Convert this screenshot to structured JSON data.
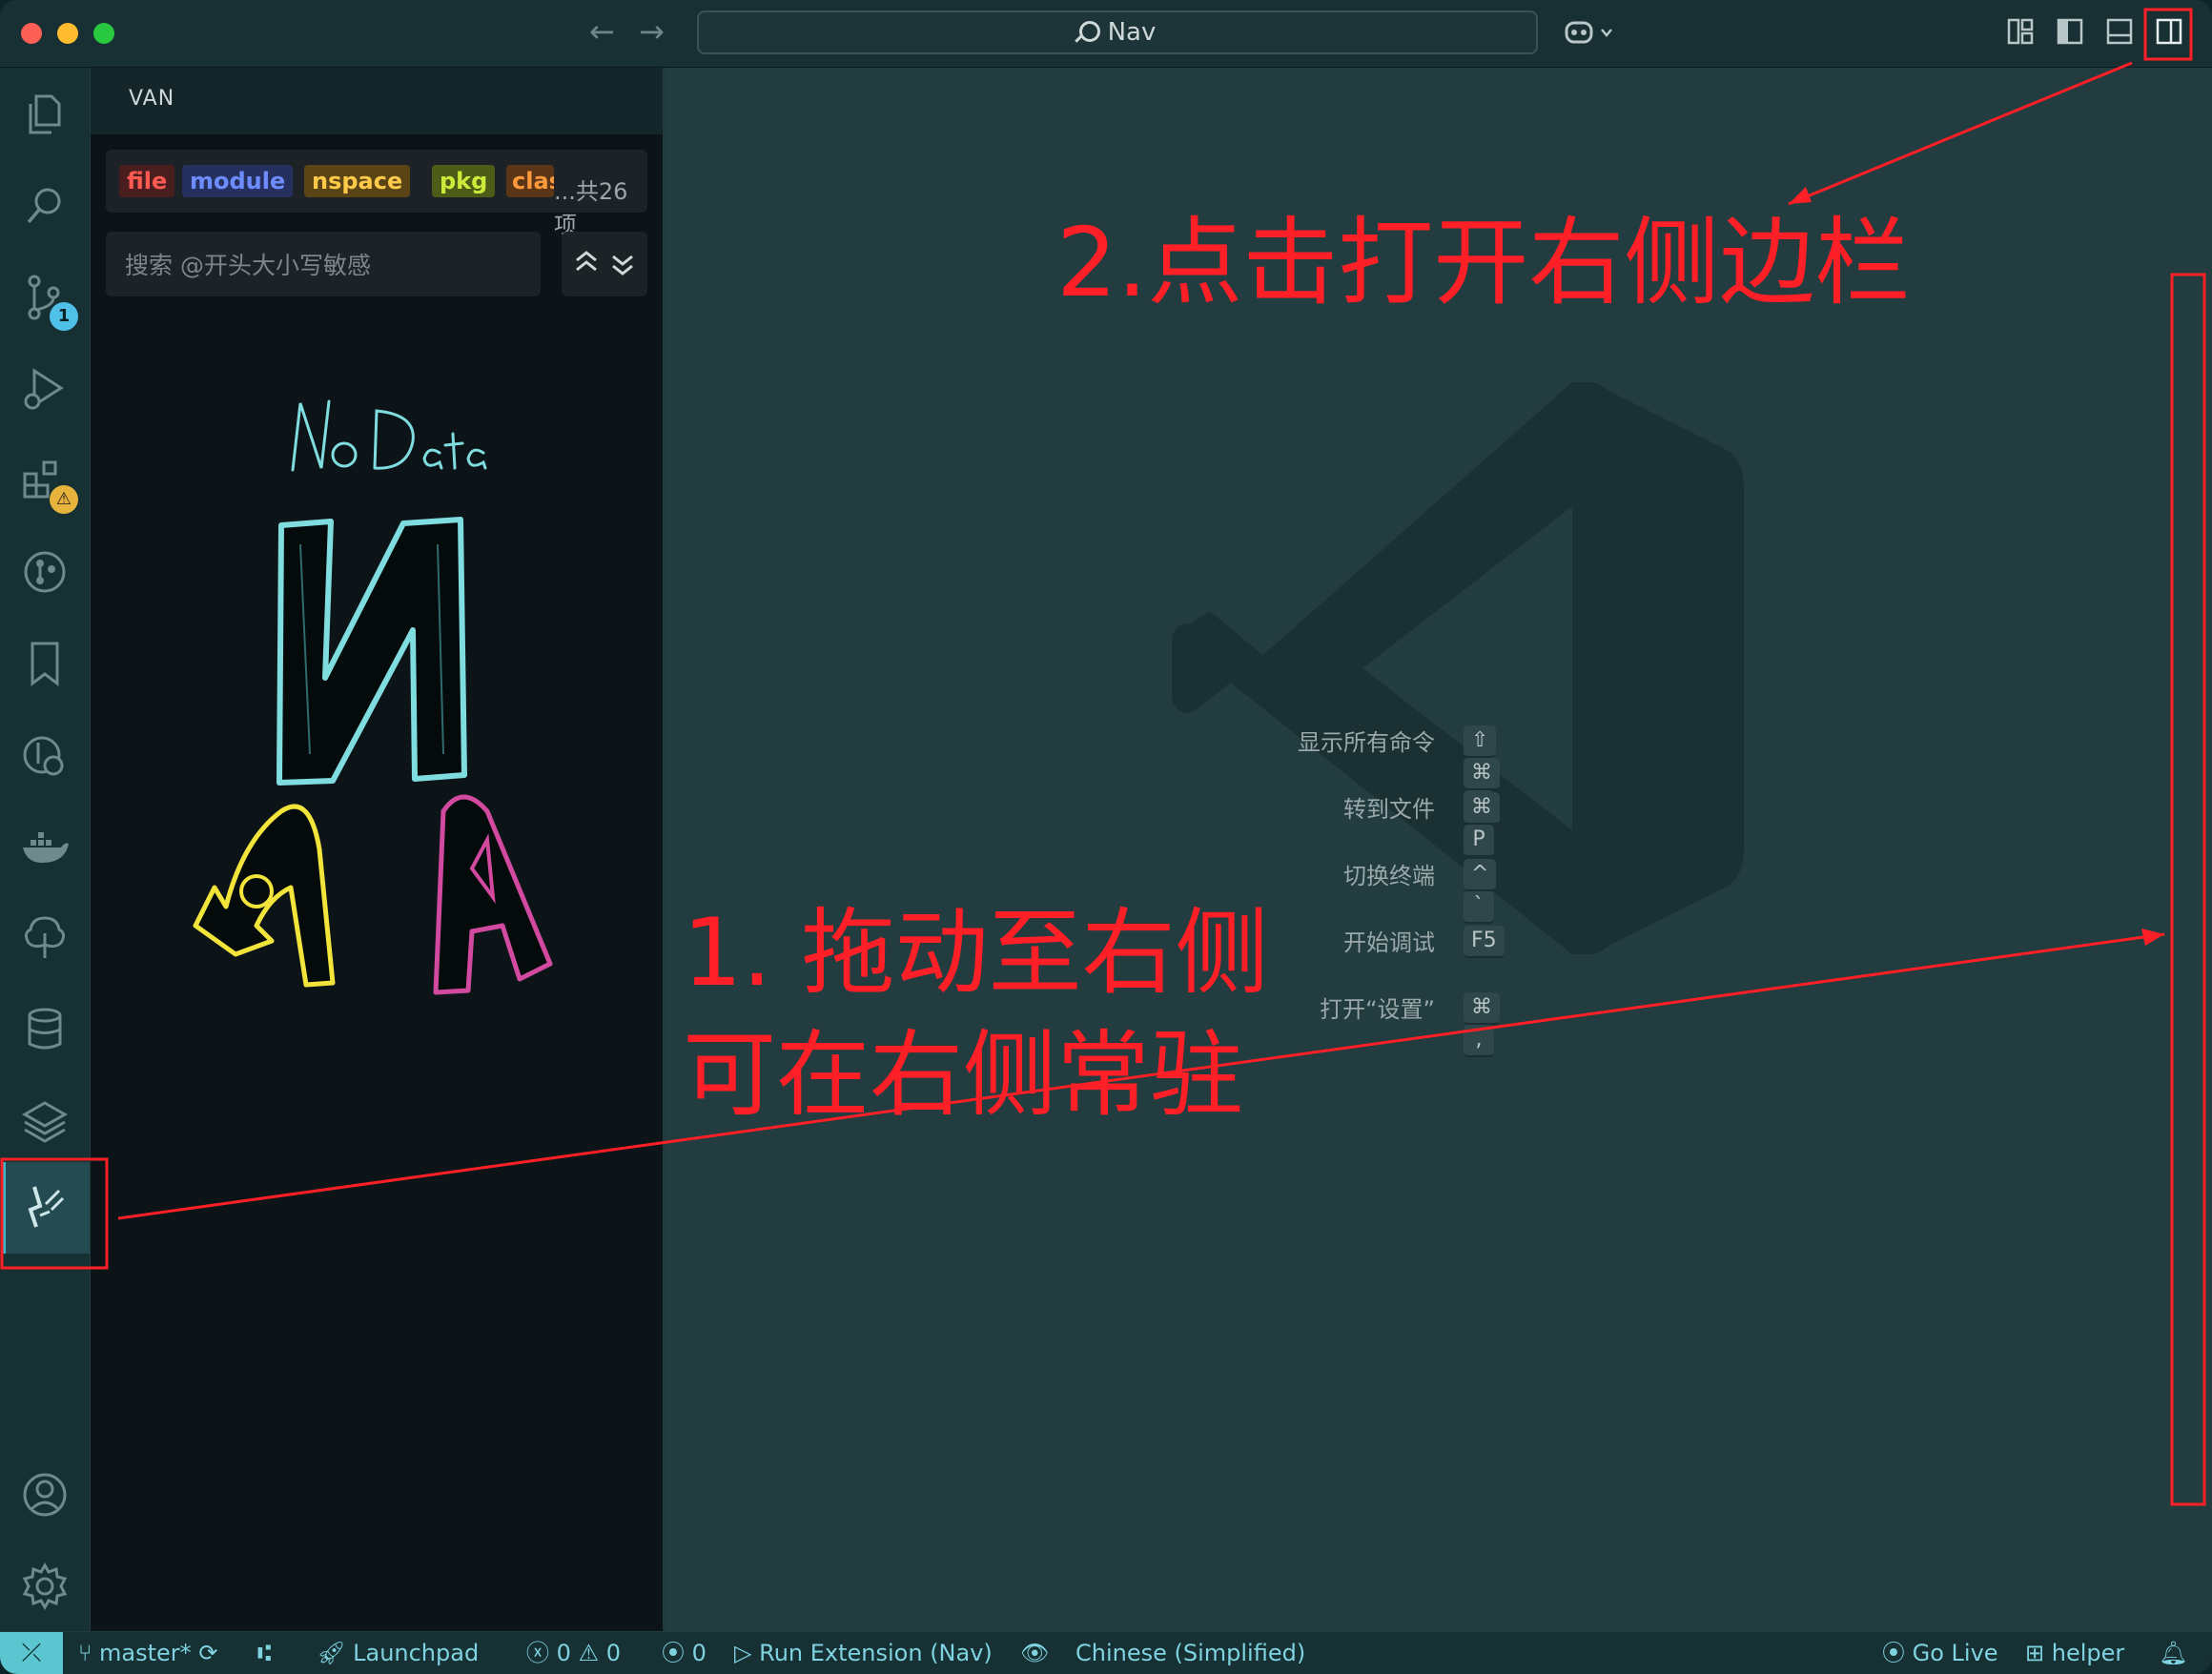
{
  "titlebar": {
    "command_center_text": "Nav"
  },
  "sidebar": {
    "title": "VAN",
    "tags": [
      "file",
      "module",
      "nspace",
      "pkg",
      "class"
    ],
    "tag_overflow": "...共26项",
    "search_placeholder": "搜索 @开头大小写敏感",
    "empty_art": "No Data NAVA"
  },
  "activity_bar": {
    "source_control_badge": "1",
    "extensions_badge": "⚠"
  },
  "editor": {
    "shortcuts": [
      {
        "label": "显示所有命令",
        "keys": [
          "⇧",
          "⌘",
          "P"
        ]
      },
      {
        "label": "转到文件",
        "keys": [
          "⌘",
          "P"
        ]
      },
      {
        "label": "切换终端",
        "keys": [
          "^",
          "`"
        ]
      },
      {
        "label": "开始调试",
        "keys": [
          "F5"
        ]
      },
      {
        "label": "打开“设置”",
        "keys": [
          "⌘",
          ","
        ]
      }
    ]
  },
  "statusbar": {
    "branch": "master*",
    "launchpad": "Launchpad",
    "errors": "0",
    "warnings": "0",
    "ports": "0",
    "run_extension": "Run Extension (Nav)",
    "language": "Chinese (Simplified)",
    "go_live": "Go Live",
    "helper": "helper"
  },
  "annotations": {
    "step1_line1": "1. 拖动至右侧",
    "step1_line2": "可在右侧常驻",
    "step2": "2.点击打开右侧边栏",
    "color": "#ff1f26"
  }
}
